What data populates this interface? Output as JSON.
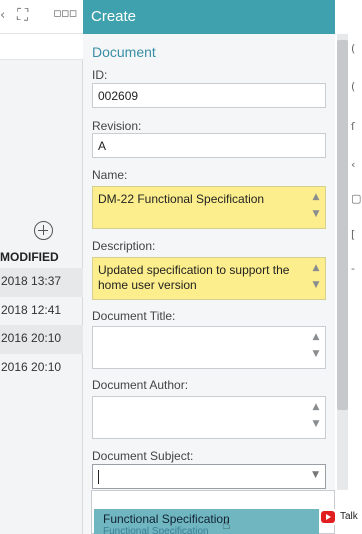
{
  "left_panel": {
    "column_header": "MODIFIED",
    "dates": [
      "2018 13:37",
      "2018 12:41",
      "2016 20:10",
      "2016 20:10"
    ]
  },
  "dialog": {
    "title": "Create",
    "section": "Document",
    "fields": {
      "id": {
        "label": "ID:",
        "value": "002609"
      },
      "revision": {
        "label": "Revision:",
        "value": "A"
      },
      "name": {
        "label": "Name:",
        "value": "DM-22 Functional Specification"
      },
      "description": {
        "label": "Description:",
        "value": "Updated specification to support the home user version"
      },
      "document_title": {
        "label": "Document Title:",
        "value": ""
      },
      "document_author": {
        "label": "Document Author:",
        "value": ""
      },
      "document_subject": {
        "label": "Document Subject:",
        "value": ""
      }
    },
    "dropdown": {
      "item_label": "Functional Specification",
      "item_sub": "Functional Specification"
    }
  },
  "overlay": {
    "talk_label": "Talk"
  },
  "icons": {
    "spin_up": "▲",
    "spin_down": "▼",
    "chevron": "▼"
  },
  "colors": {
    "header": "#3fa1ad",
    "highlight_field": "#fcee8c",
    "dropdown_selected": "#6fb6c0",
    "section_title": "#3a8fa6"
  }
}
